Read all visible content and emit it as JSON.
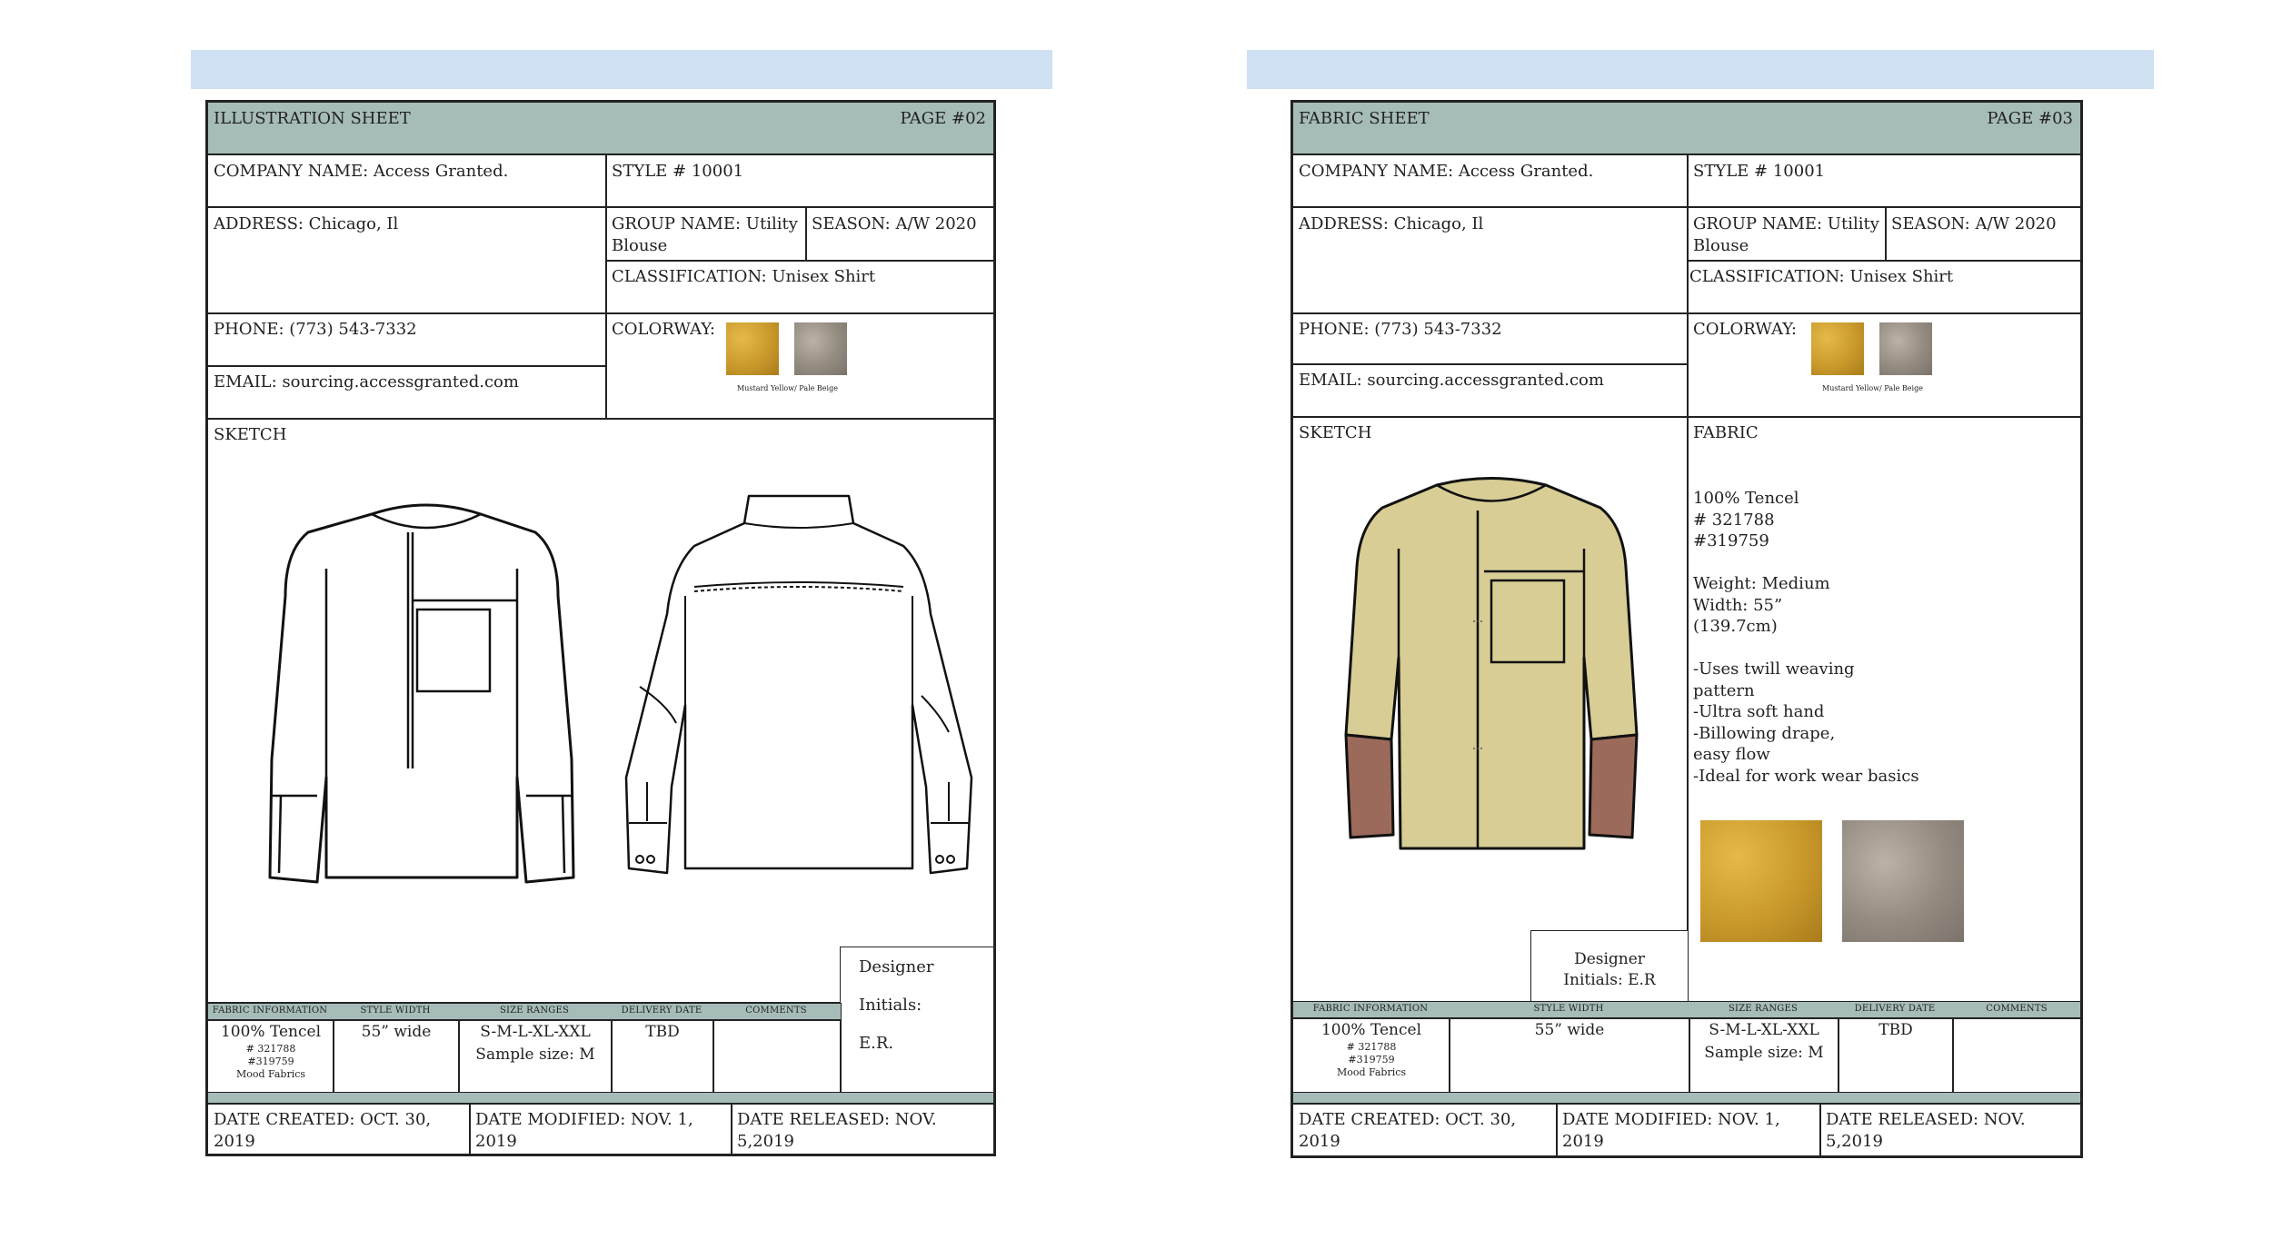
{
  "left": {
    "header_title": "ILLUSTRATION SHEET",
    "page_no": "PAGE #02",
    "company": "COMPANY NAME: Access Granted.",
    "style": "STYLE # 10001",
    "address": "ADDRESS: Chicago, Il",
    "group_line1": "GROUP NAME: Utility",
    "group_line2": "Blouse",
    "season": "SEASON: A/W 2020",
    "classification": "CLASSIFICATION: Unisex Shirt",
    "phone": "PHONE: (773) 543-7332",
    "colorway": "COLORWAY:",
    "colorway_caption": "Mustard Yellow/ Pale Beige",
    "email": "EMAIL: sourcing.accessgranted.com",
    "sketch": "SKETCH",
    "designer_line1": "Designer",
    "designer_line2": "Initials:",
    "designer_line3": "E.R.",
    "table_headers": [
      "FABRIC INFORMATION",
      "STYLE WIDTH",
      "SIZE RANGES",
      "DELIVERY DATE",
      "COMMENTS"
    ],
    "fabric_main": "100% Tencel",
    "fabric_sub1": "# 321788",
    "fabric_sub2": "#319759",
    "fabric_sub3": "Mood Fabrics",
    "width": "55” wide",
    "size1": "S-M-L-XL-XXL",
    "size2": "Sample size: M",
    "delivery": "TBD",
    "date_created": "DATE CREATED: OCT. 30, 2019",
    "date_modified": "DATE MODIFIED: NOV. 1, 2019",
    "date_released": "DATE RELEASED: NOV. 5,2019"
  },
  "right": {
    "header_title": "FABRIC SHEET",
    "page_no": "PAGE #03",
    "company": "COMPANY NAME: Access Granted.",
    "style": "STYLE # 10001",
    "address": "ADDRESS: Chicago, Il",
    "group_line1": "GROUP NAME: Utility",
    "group_line2": "Blouse",
    "season": "SEASON: A/W 2020",
    "classification": "CLASSIFICATION: Unisex Shirt",
    "phone": "PHONE: (773) 543-7332",
    "colorway": "COLORWAY:",
    "colorway_caption": "Mustard Yellow/ Pale Beige",
    "email": "EMAIL: sourcing.accessgranted.com",
    "sketch": "SKETCH",
    "fabric_title": "FABRIC",
    "fabric_lines": [
      "100% Tencel",
      "# 321788",
      "#319759",
      "",
      "Weight: Medium",
      "Width: 55”",
      "(139.7cm)",
      "",
      "-Uses twill weaving",
      "pattern",
      "-Ultra soft hand",
      "-Billowing drape,",
      "easy flow",
      "-Ideal for work wear basics"
    ],
    "designer_line1": "Designer",
    "designer_line2": "Initials: E.R",
    "table_headers": [
      "FABRIC INFORMATION",
      "STYLE WIDTH",
      "SIZE RANGES",
      "DELIVERY DATE",
      "COMMENTS"
    ],
    "fabric_main": "100% Tencel",
    "fabric_sub1": "# 321788",
    "fabric_sub2": "#319759",
    "fabric_sub3": "Mood Fabrics",
    "width": "55” wide",
    "size1": "S-M-L-XL-XXL",
    "size2": "Sample size: M",
    "delivery": "TBD",
    "date_created": "DATE CREATED: OCT. 30, 2019",
    "date_modified": "DATE MODIFIED: NOV. 1, 2019",
    "date_released": "DATE RELEASED: NOV. 5,2019"
  }
}
